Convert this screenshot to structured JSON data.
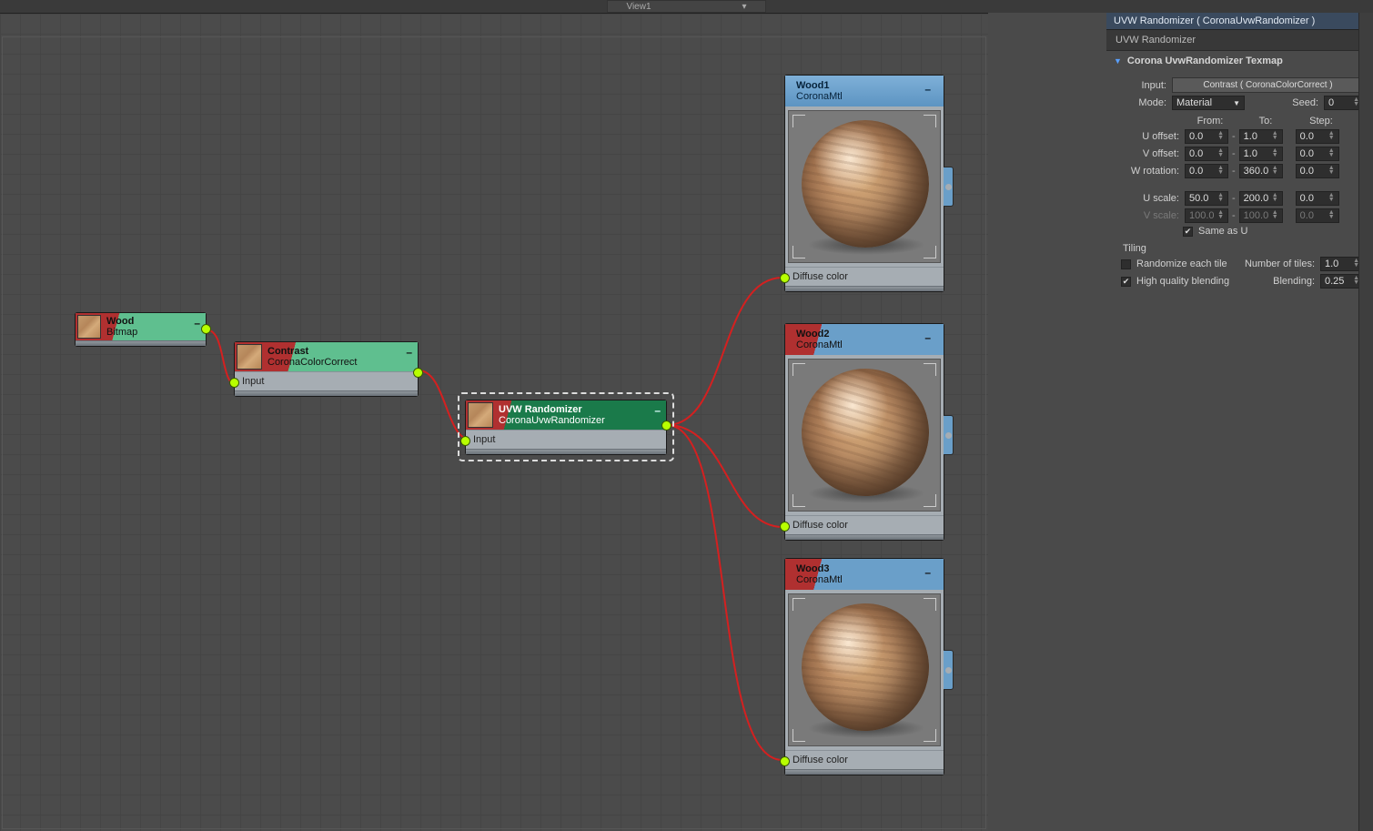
{
  "top_tab": "View1",
  "nodes": {
    "wood_bitmap": {
      "title": "Wood",
      "subtitle": "Bitmap"
    },
    "contrast": {
      "title": "Contrast",
      "subtitle": "CoronaColorCorrect",
      "input_label": "Input"
    },
    "uvw": {
      "title": "UVW Randomizer",
      "subtitle": "CoronaUvwRandomizer",
      "input_label": "Input"
    },
    "wood1": {
      "title": "Wood1",
      "subtitle": "CoronaMtl",
      "slot": "Diffuse color"
    },
    "wood2": {
      "title": "Wood2",
      "subtitle": "CoronaMtl",
      "slot": "Diffuse color"
    },
    "wood3": {
      "title": "Wood3",
      "subtitle": "CoronaMtl",
      "slot": "Diffuse color"
    }
  },
  "panel": {
    "title": "UVW Randomizer  ( CoronaUvwRandomizer )",
    "sub": "UVW Randomizer",
    "section": "Corona UvwRandomizer Texmap",
    "input_label": "Input:",
    "input_value": "Contrast  ( CoronaColorCorrect )",
    "mode_label": "Mode:",
    "mode_value": "Material",
    "seed_label": "Seed:",
    "seed_value": "0",
    "col_from": "From:",
    "col_to": "To:",
    "col_step": "Step:",
    "u_offset": {
      "label": "U offset:",
      "from": "0.0",
      "to": "1.0",
      "step": "0.0"
    },
    "v_offset": {
      "label": "V offset:",
      "from": "0.0",
      "to": "1.0",
      "step": "0.0"
    },
    "w_rot": {
      "label": "W rotation:",
      "from": "0.0",
      "to": "360.0",
      "step": "0.0"
    },
    "u_scale": {
      "label": "U scale:",
      "from": "50.0",
      "to": "200.0",
      "step": "0.0"
    },
    "v_scale": {
      "label": "V scale:",
      "from": "100.0",
      "to": "100.0",
      "step": "0.0"
    },
    "same_as_u": "Same as U",
    "tiling_label": "Tiling",
    "rand_tile": "Randomize each tile",
    "hq_blend": "High quality blending",
    "num_tiles_label": "Number of tiles:",
    "num_tiles": "1.0",
    "blending_label": "Blending:",
    "blending": "0.25"
  }
}
